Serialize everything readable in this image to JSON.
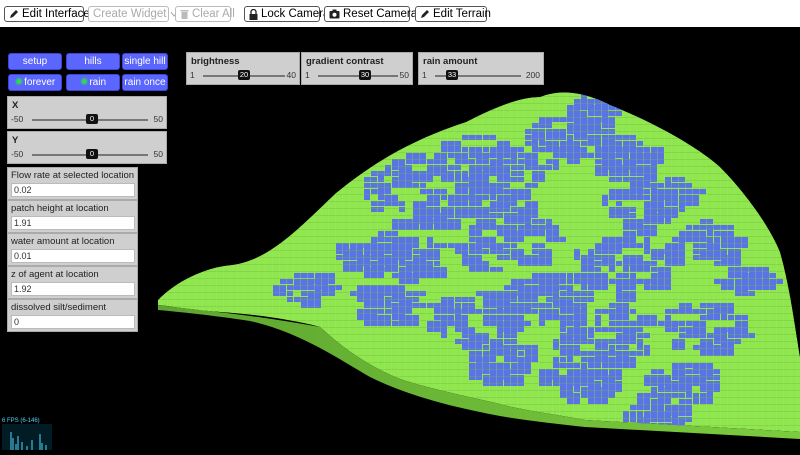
{
  "toolbar": {
    "edit_interface": "Edit Interface",
    "create_widget": "Create Widget",
    "clear_all": "Clear All",
    "lock_camera": "Lock Camera",
    "reset_camera": "Reset Camera",
    "edit_terrain": "Edit Terrain"
  },
  "buttons": {
    "setup": "setup",
    "hills": "hills",
    "single_hill": "single hill",
    "forever": "forever",
    "rain": "rain",
    "rain_once": "rain once"
  },
  "sliders": {
    "x": {
      "label": "X",
      "min": "-50",
      "max": "50",
      "value": "0"
    },
    "y": {
      "label": "Y",
      "min": "-50",
      "max": "50",
      "value": "0"
    },
    "brightness": {
      "label": "brightness",
      "min": "1",
      "max": "40",
      "value": "20"
    },
    "gradient_contrast": {
      "label": "gradient contrast",
      "min": "1",
      "max": "50",
      "value": "30"
    },
    "rain_amount": {
      "label": "rain amount",
      "min": "1",
      "max": "200",
      "value": "33"
    }
  },
  "monitors": [
    {
      "label": "Flow rate at selected location",
      "value": "0.02"
    },
    {
      "label": "patch height at location",
      "value": "1.91"
    },
    {
      "label": "water amount at location",
      "value": "0.01"
    },
    {
      "label": "z of agent at location",
      "value": "1.92"
    },
    {
      "label": "dissolved silt/sediment",
      "value": "0"
    }
  ],
  "fps_label": "6 FPS (6-146)",
  "colors": {
    "terrain_green": "#8fe64e",
    "water_blue": "#5b74e4",
    "button_blue": "#5b66ff"
  }
}
